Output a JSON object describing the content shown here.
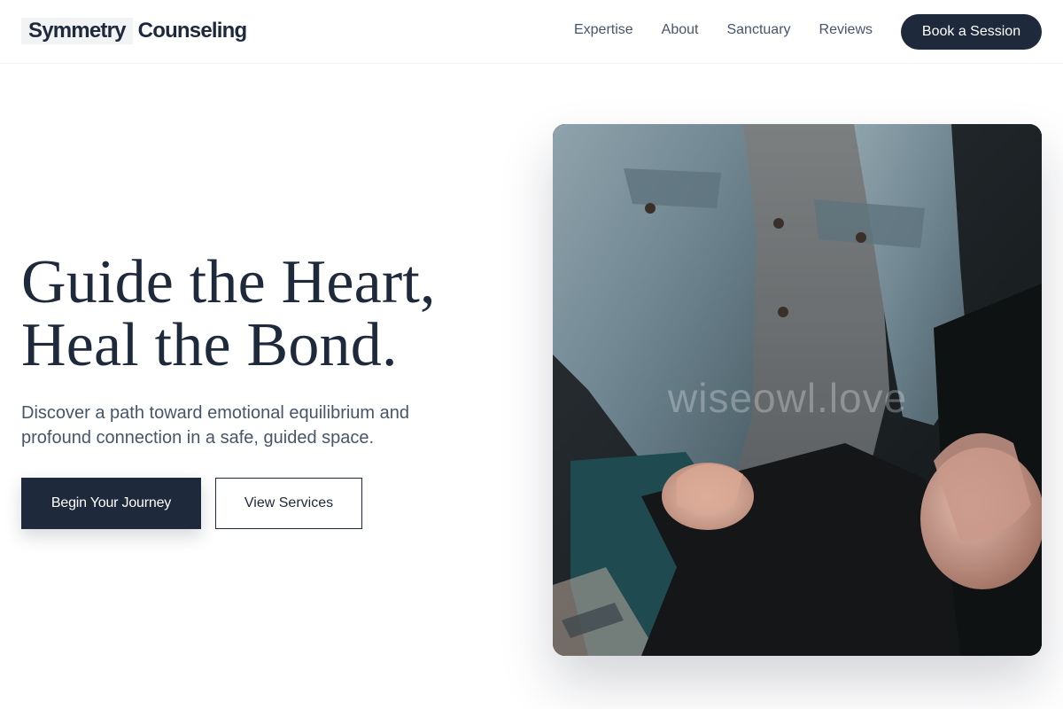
{
  "brand": {
    "part1": "Symmetry",
    "part2": "Counseling"
  },
  "nav": {
    "items": [
      "Expertise",
      "About",
      "Sanctuary",
      "Reviews"
    ],
    "cta": "Book a Session"
  },
  "hero": {
    "title_line1": "Guide the Heart,",
    "title_line2": "Heal the Bond.",
    "subtitle": "Discover a path toward emotional equilibrium and profound connection in a safe, guided space.",
    "primary_button": "Begin Your Journey",
    "secondary_button": "View Services",
    "image_watermark": "wiseowl.love"
  },
  "colors": {
    "navy": "#1e293b",
    "slate": "#475569",
    "logo_highlight": "#f1f3f5"
  }
}
